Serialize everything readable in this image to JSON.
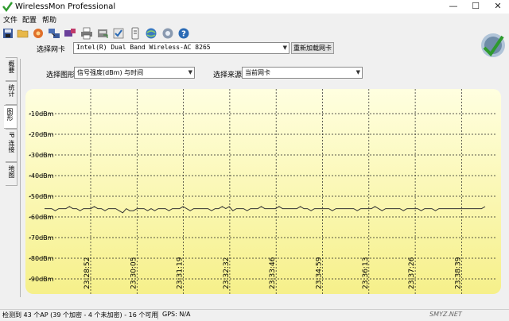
{
  "window": {
    "title": "WirelessMon Professional"
  },
  "menu": [
    "文件",
    "配置",
    "帮助"
  ],
  "toolbar_icons": [
    "save-icon",
    "open-folder-icon",
    "record-icon",
    "network-icon",
    "adapter-icon",
    "print-icon",
    "export-icon",
    "check-icon",
    "log-icon",
    "globe-icon",
    "help-info-icon",
    "world-icon",
    "help-icon"
  ],
  "adapter": {
    "label": "选择网卡",
    "selected": "Intel(R) Dual Band Wireless-AC 8265",
    "reload_label": "重新加载网卡"
  },
  "tabs": [
    "概要",
    "统计",
    "图形",
    "IP 连接",
    "地图"
  ],
  "graph": {
    "type_label": "选择图形",
    "type_value": "信号强度(dBm) 与时间",
    "source_label": "选择来源",
    "source_value": "当前网卡"
  },
  "chart_data": {
    "type": "line",
    "y_tick_labels": [
      "-10dBm",
      "-20dBm",
      "-30dBm",
      "-40dBm",
      "-50dBm",
      "-60dBm",
      "-70dBm",
      "-80dBm",
      "-90dBm"
    ],
    "ylim": [
      0,
      -100
    ],
    "x_tick_labels": [
      "23:28:52",
      "23:30:05",
      "23:31:19",
      "23:32:32",
      "23:33:46",
      "23:34:59",
      "23:36:13",
      "23:37:26",
      "23:38:39"
    ],
    "grid": true,
    "series": [
      {
        "values": [
          -56,
          -56,
          -56,
          -57,
          -56,
          -56,
          -56,
          -55,
          -56,
          -56,
          -57,
          -56,
          -56,
          -56,
          -55,
          -56,
          -56,
          -57,
          -56,
          -56,
          -56,
          -57,
          -58,
          -56,
          -57,
          -57,
          -56,
          -56,
          -56,
          -57,
          -56,
          -57,
          -56,
          -56,
          -56,
          -57,
          -56,
          -56,
          -56,
          -55,
          -56,
          -57,
          -56,
          -56,
          -56,
          -56,
          -56,
          -57,
          -56,
          -56,
          -55,
          -56,
          -55,
          -57,
          -56,
          -56,
          -56,
          -57,
          -56,
          -56,
          -56,
          -55,
          -56,
          -56,
          -56,
          -56,
          -55,
          -56,
          -56,
          -56,
          -56,
          -56,
          -55,
          -56,
          -56,
          -57,
          -56,
          -56,
          -56,
          -56,
          -56,
          -57,
          -56,
          -56,
          -56,
          -56,
          -56,
          -56,
          -57,
          -56,
          -56,
          -56,
          -56,
          -55,
          -56,
          -57,
          -56,
          -56,
          -56,
          -56,
          -56,
          -57,
          -56,
          -56,
          -56,
          -56,
          -57,
          -56,
          -56,
          -56,
          -57,
          -56,
          -56,
          -56,
          -56,
          -56,
          -56,
          -56,
          -56,
          -56,
          -56,
          -56,
          -56,
          -56,
          -55
        ],
        "color": "#333333"
      }
    ]
  },
  "status": {
    "ap_count": "检测到 43 个AP (39 个加密 - 4 个未加密) - 16 个可用",
    "gps": "GPS: N/A"
  },
  "watermark": "SMYZ.NET"
}
